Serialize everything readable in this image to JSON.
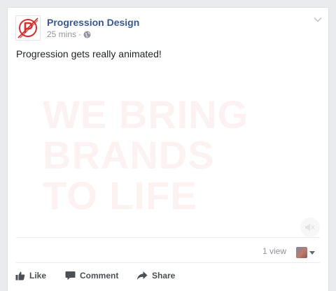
{
  "post": {
    "page_name": "Progression Design",
    "timestamp": "25 mins",
    "separator": "·",
    "privacy_icon": "globe-icon",
    "text": "Progression gets really animated!"
  },
  "media": {
    "lines": [
      "WE BRING",
      "BRANDS",
      "TO LIFE"
    ],
    "mute_icon": "speaker-muted-icon"
  },
  "footer": {
    "views": "1 view"
  },
  "actions": {
    "like": "Like",
    "comment": "Comment",
    "share": "Share"
  },
  "colors": {
    "brand_red": "#d32f2f",
    "link_blue": "#365899",
    "meta_gray": "#90949c",
    "action_gray": "#4b4f56"
  }
}
